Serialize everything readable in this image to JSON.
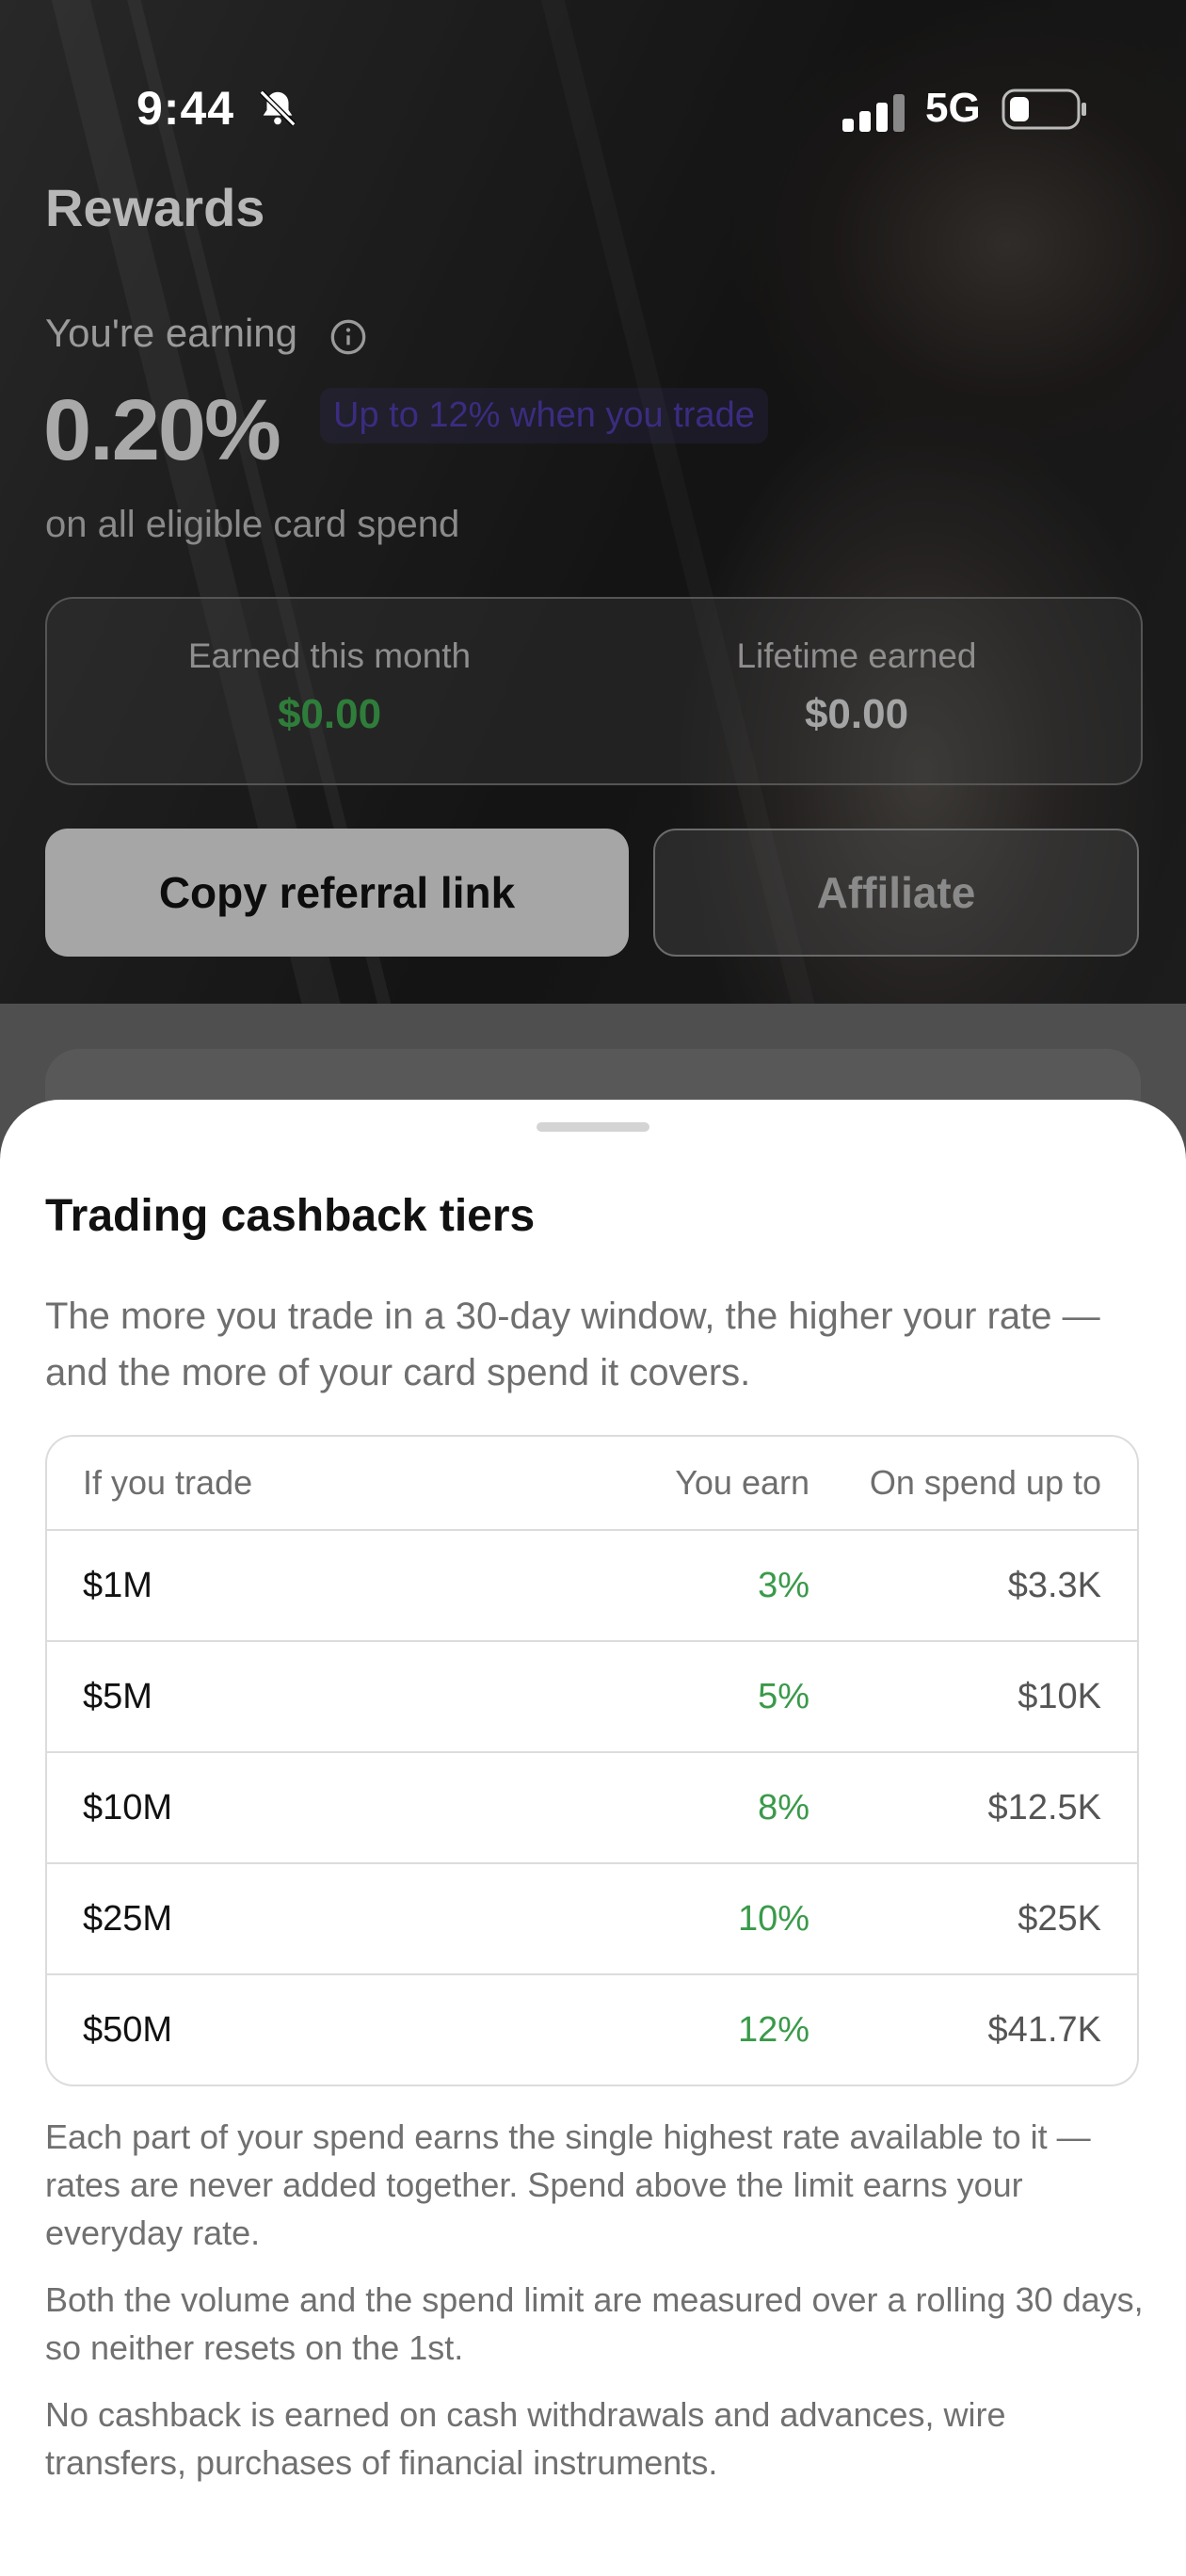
{
  "status_bar": {
    "time": "9:44",
    "network": "5G"
  },
  "header": {
    "title": "Rewards"
  },
  "earning": {
    "label": "You're earning",
    "rate": "0.20%",
    "promo": "Up to 12% when you trade",
    "subline": "on all eligible card spend"
  },
  "stats": [
    {
      "label": "Earned this month",
      "value": "$0.00"
    },
    {
      "label": "Lifetime earned",
      "value": "$0.00"
    }
  ],
  "buttons": {
    "copy_referral": "Copy referral link",
    "affiliate": "Affiliate"
  },
  "sheet": {
    "title": "Trading cashback tiers",
    "description": "The more you trade in a 30-day window, the higher your rate — and the more of your card spend it covers.",
    "table": {
      "headers": [
        "If you trade",
        "You earn",
        "On spend up to"
      ],
      "rows": [
        [
          "$1M",
          "3%",
          "$3.3K"
        ],
        [
          "$5M",
          "5%",
          "$10K"
        ],
        [
          "$10M",
          "8%",
          "$12.5K"
        ],
        [
          "$25M",
          "10%",
          "$25K"
        ],
        [
          "$50M",
          "12%",
          "$41.7K"
        ]
      ]
    },
    "notes": [
      "Each part of your spend earns the single highest rate available to it — rates are never added together. Spend above the limit earns your everyday rate.",
      "Both the volume and the spend limit are measured over a rolling 30 days, so neither resets on the 1st.",
      "No cashback is earned on cash withdrawals and advances, wire transfers, purchases of financial instruments."
    ]
  },
  "colors": {
    "accent_green": "#3a9a4a",
    "promo_purple": "#3b2c80"
  }
}
